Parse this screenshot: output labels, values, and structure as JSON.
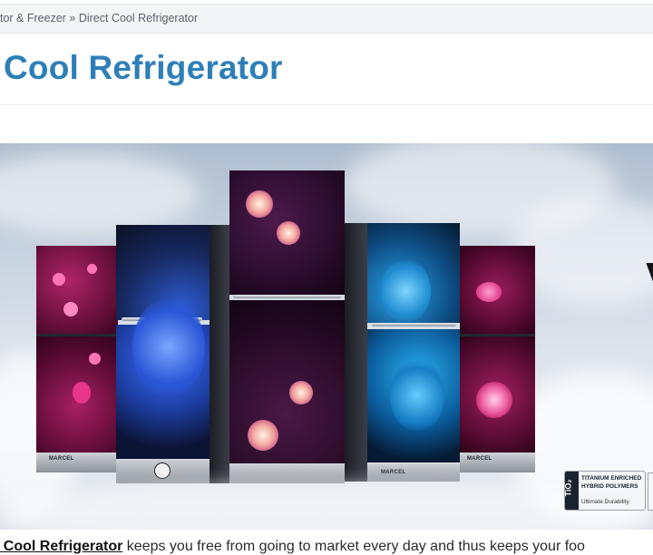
{
  "breadcrumb": {
    "text": "tor & Freezer » Direct Cool Refrigerator"
  },
  "page": {
    "title": "Cool Refrigerator"
  },
  "banner": {
    "brand": "MARCEL",
    "cut_heading_letter": "V",
    "badge": {
      "symbol": "TiO₂",
      "line1": "TITANIUM ENRICHED",
      "line2": "HYBRID POLYMERS",
      "line3": "Ultimate Durability"
    }
  },
  "intro": {
    "bold": "t Cool Refrigerator",
    "text": " keeps you free from going to market every day and thus keeps your foo"
  }
}
